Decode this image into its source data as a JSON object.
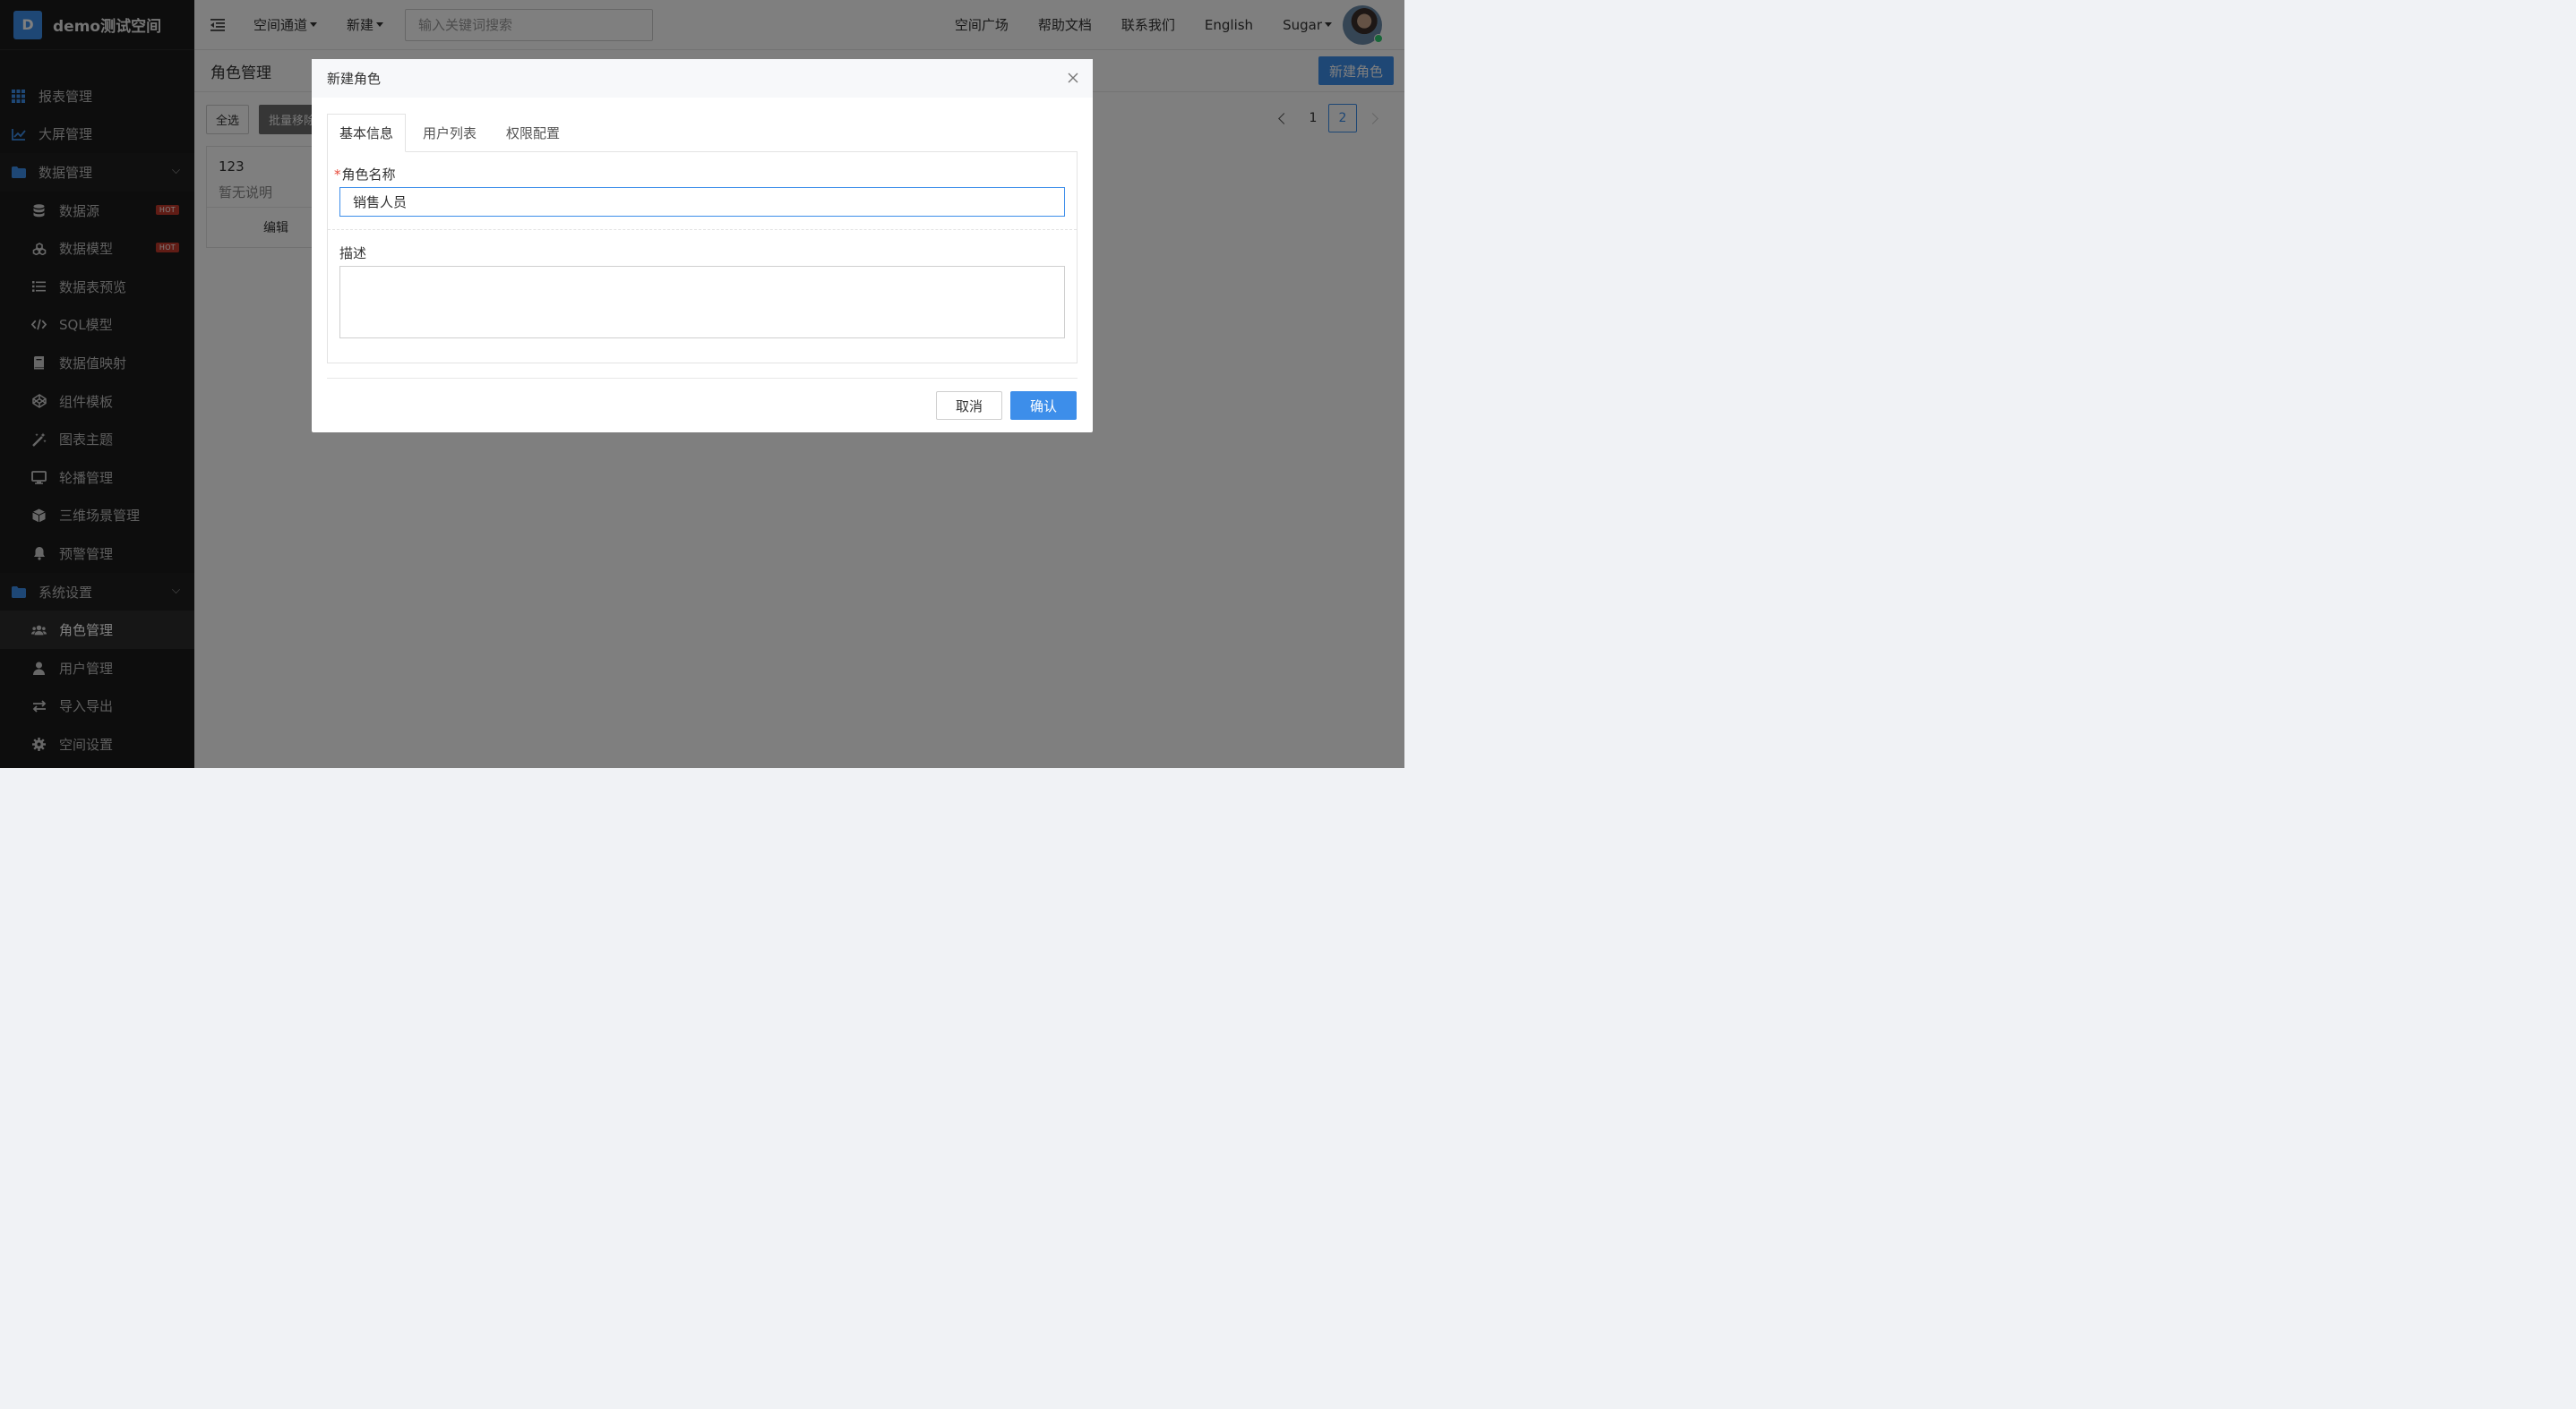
{
  "brand": {
    "logo_letter": "D",
    "name": "demo测试空间"
  },
  "sidebar": {
    "items": [
      {
        "label": "报表管理",
        "icon": "grid-icon"
      },
      {
        "label": "大屏管理",
        "icon": "line-chart-icon"
      },
      {
        "label": "数据管理",
        "icon": "folder-icon",
        "expanded": true
      },
      {
        "label": "数据源",
        "icon": "database-icon",
        "badge": "HOT"
      },
      {
        "label": "数据模型",
        "icon": "cubes-icon",
        "badge": "HOT"
      },
      {
        "label": "数据表预览",
        "icon": "list-icon"
      },
      {
        "label": "SQL模型",
        "icon": "code-icon"
      },
      {
        "label": "数据值映射",
        "icon": "book-icon"
      },
      {
        "label": "组件模板",
        "icon": "codepen-icon"
      },
      {
        "label": "图表主题",
        "icon": "magic-wand-icon"
      },
      {
        "label": "轮播管理",
        "icon": "monitor-icon"
      },
      {
        "label": "三维场景管理",
        "icon": "cube-icon"
      },
      {
        "label": "预警管理",
        "icon": "bell-icon"
      },
      {
        "label": "系统设置",
        "icon": "folder-icon",
        "expanded": true
      },
      {
        "label": "角色管理",
        "icon": "users-icon",
        "active": true
      },
      {
        "label": "用户管理",
        "icon": "user-icon"
      },
      {
        "label": "导入导出",
        "icon": "exchange-icon"
      },
      {
        "label": "空间设置",
        "icon": "gear-icon"
      }
    ]
  },
  "header": {
    "nav": [
      "空间通道",
      "新建"
    ],
    "search_placeholder": "输入关键词搜索",
    "links": [
      "空间广场",
      "帮助文档",
      "联系我们",
      "English"
    ],
    "user_name": "Sugar"
  },
  "content": {
    "page_title": "角色管理",
    "new_role_button": "新建角色",
    "select_all": "全选",
    "batch_remove": "批量移除",
    "pagination": {
      "pages": [
        "1",
        "2"
      ],
      "current": "2"
    },
    "cards": [
      {
        "title": "123",
        "desc": "暂无说明",
        "edit": "编辑"
      }
    ]
  },
  "modal": {
    "title": "新建角色",
    "tabs": [
      "基本信息",
      "用户列表",
      "权限配置"
    ],
    "active_tab": "基本信息",
    "name_label": "角色名称",
    "name_required_mark": "*",
    "name_value": "销售人员",
    "desc_label": "描述",
    "desc_value": "",
    "cancel": "取消",
    "confirm": "确认"
  },
  "colors": {
    "primary": "#3d8eea",
    "sidebar_bg": "#1b1b1b",
    "hot_badge": "#c0392b",
    "required": "#e74c3c"
  }
}
